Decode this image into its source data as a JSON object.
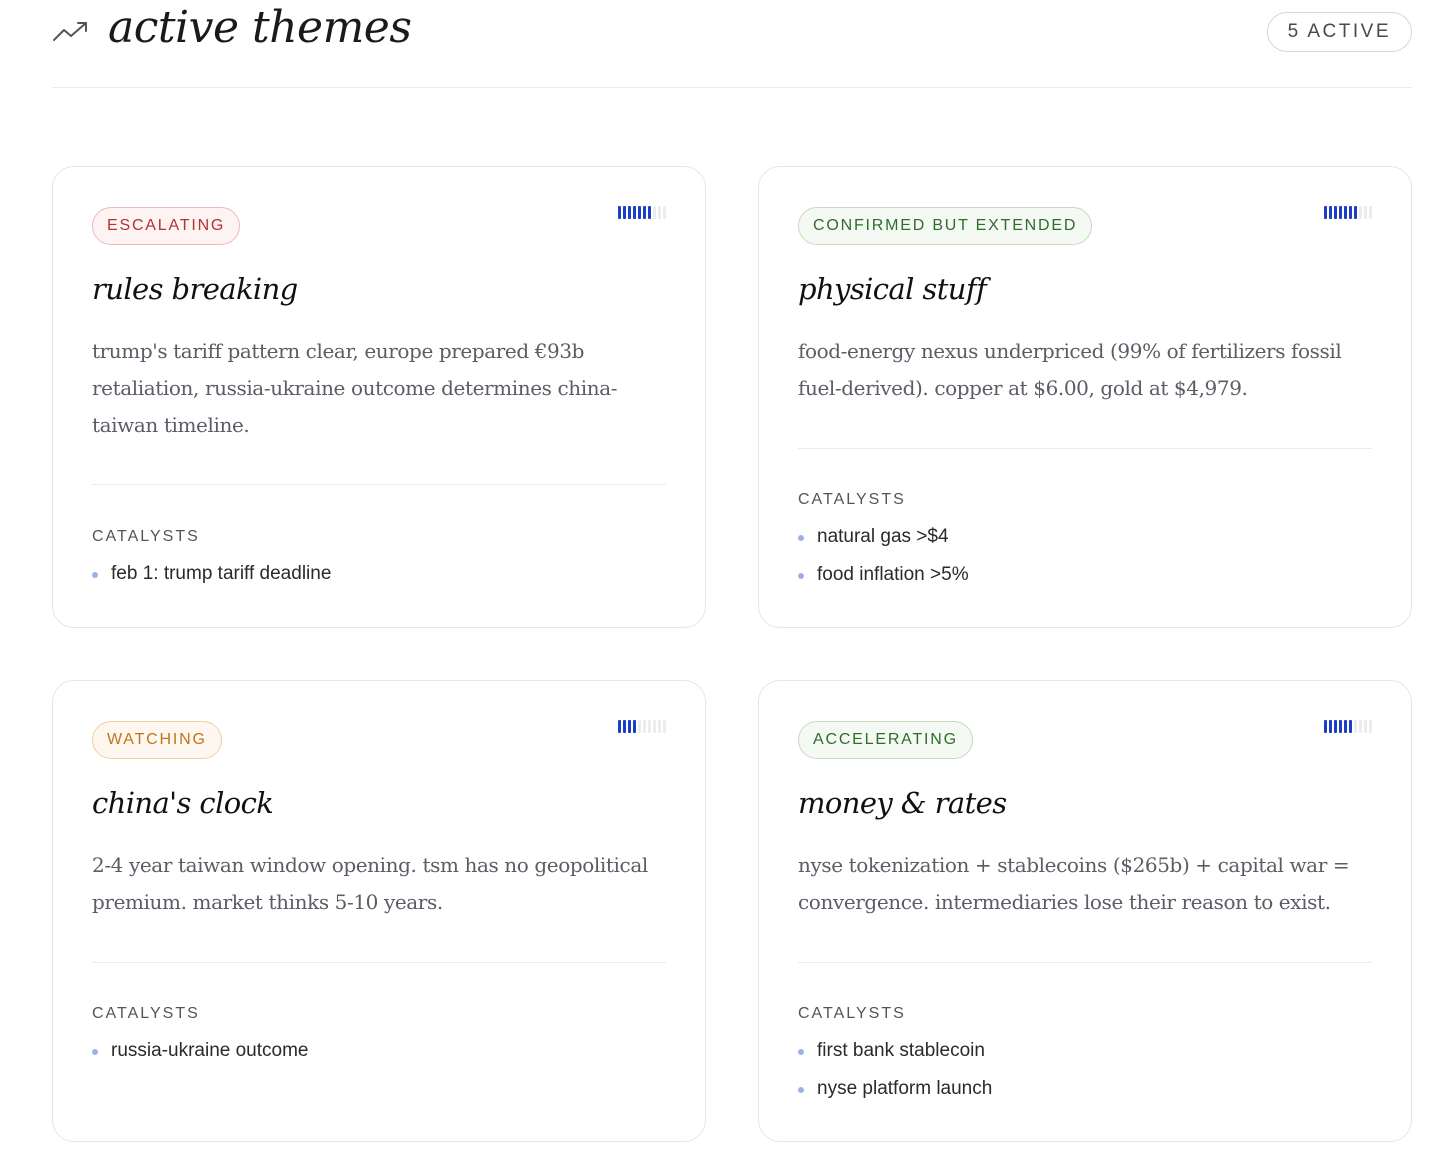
{
  "header": {
    "title": "active themes",
    "icon": "trending-up-icon",
    "count_badge": "5 ACTIVE"
  },
  "colors": {
    "strength_on": "#1a3ec8",
    "strength_off": "#ececec",
    "escalating": "#b33232",
    "confirmed": "#2f6e2a",
    "watching": "#c2741a",
    "accelerating": "#2f6e2a",
    "bullet": "#9db1e8"
  },
  "themes": [
    {
      "status": "ESCALATING",
      "strength": {
        "filled": 7,
        "total": 10
      },
      "title": "rules breaking",
      "description": "trump's tariff pattern clear, europe prepared €93b retaliation, russia-ukraine outcome determines china-taiwan timeline.",
      "catalysts_label": "CATALYSTS",
      "catalysts": [
        "feb 1: trump tariff deadline"
      ]
    },
    {
      "status": "CONFIRMED BUT EXTENDED",
      "strength": {
        "filled": 7,
        "total": 10
      },
      "title": "physical stuff",
      "description": "food-energy nexus underpriced (99% of fertilizers fossil fuel-derived). copper at $6.00, gold at $4,979.",
      "catalysts_label": "CATALYSTS",
      "catalysts": [
        "natural gas >$4",
        "food inflation >5%"
      ]
    },
    {
      "status": "WATCHING",
      "strength": {
        "filled": 4,
        "total": 10
      },
      "title": "china's clock",
      "description": "2-4 year taiwan window opening. tsm has no geopolitical premium. market thinks 5-10 years.",
      "catalysts_label": "CATALYSTS",
      "catalysts": [
        "russia-ukraine outcome"
      ]
    },
    {
      "status": "ACCELERATING",
      "strength": {
        "filled": 6,
        "total": 10
      },
      "title": "money & rates",
      "description": "nyse tokenization + stablecoins ($265b) + capital war = convergence. intermediaries lose their reason to exist.",
      "catalysts_label": "CATALYSTS",
      "catalysts": [
        "first bank stablecoin",
        "nyse platform launch"
      ]
    }
  ]
}
